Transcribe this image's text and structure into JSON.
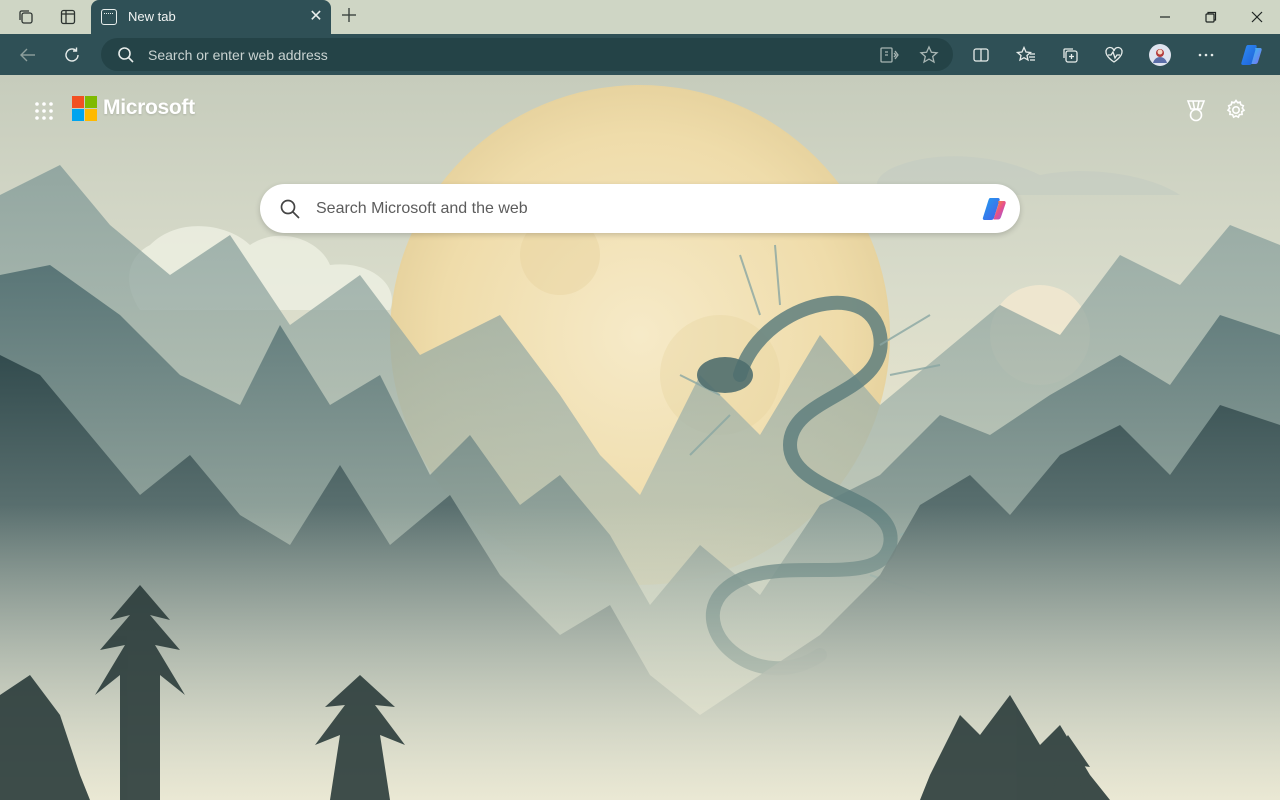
{
  "browser": {
    "tab": {
      "title": "New tab"
    },
    "address_bar": {
      "placeholder": "Search or enter web address"
    }
  },
  "new_tab_page": {
    "brand": "Microsoft",
    "search": {
      "placeholder": "Search Microsoft and the web"
    }
  },
  "theme": {
    "toolbar_color": "#2f5056",
    "titlebar_color": "#cfd6c5",
    "ms_logo_colors": [
      "#f25022",
      "#7fba00",
      "#00a4ef",
      "#ffb900"
    ]
  },
  "icons": {
    "titlebar": [
      "workspaces-icon",
      "vertical-tabs-icon",
      "new-tab-icon",
      "minimize-icon",
      "restore-icon",
      "close-icon"
    ],
    "toolbar": [
      "back-icon",
      "refresh-icon",
      "search-icon",
      "read-aloud-icon",
      "favorite-star-icon",
      "split-screen-icon",
      "favorites-icon",
      "collections-icon",
      "browser-essentials-icon",
      "profile-avatar",
      "more-icon",
      "copilot-icon"
    ],
    "page": [
      "apps-grid-icon",
      "rewards-icon",
      "settings-icon",
      "search-icon",
      "copilot-icon"
    ]
  }
}
